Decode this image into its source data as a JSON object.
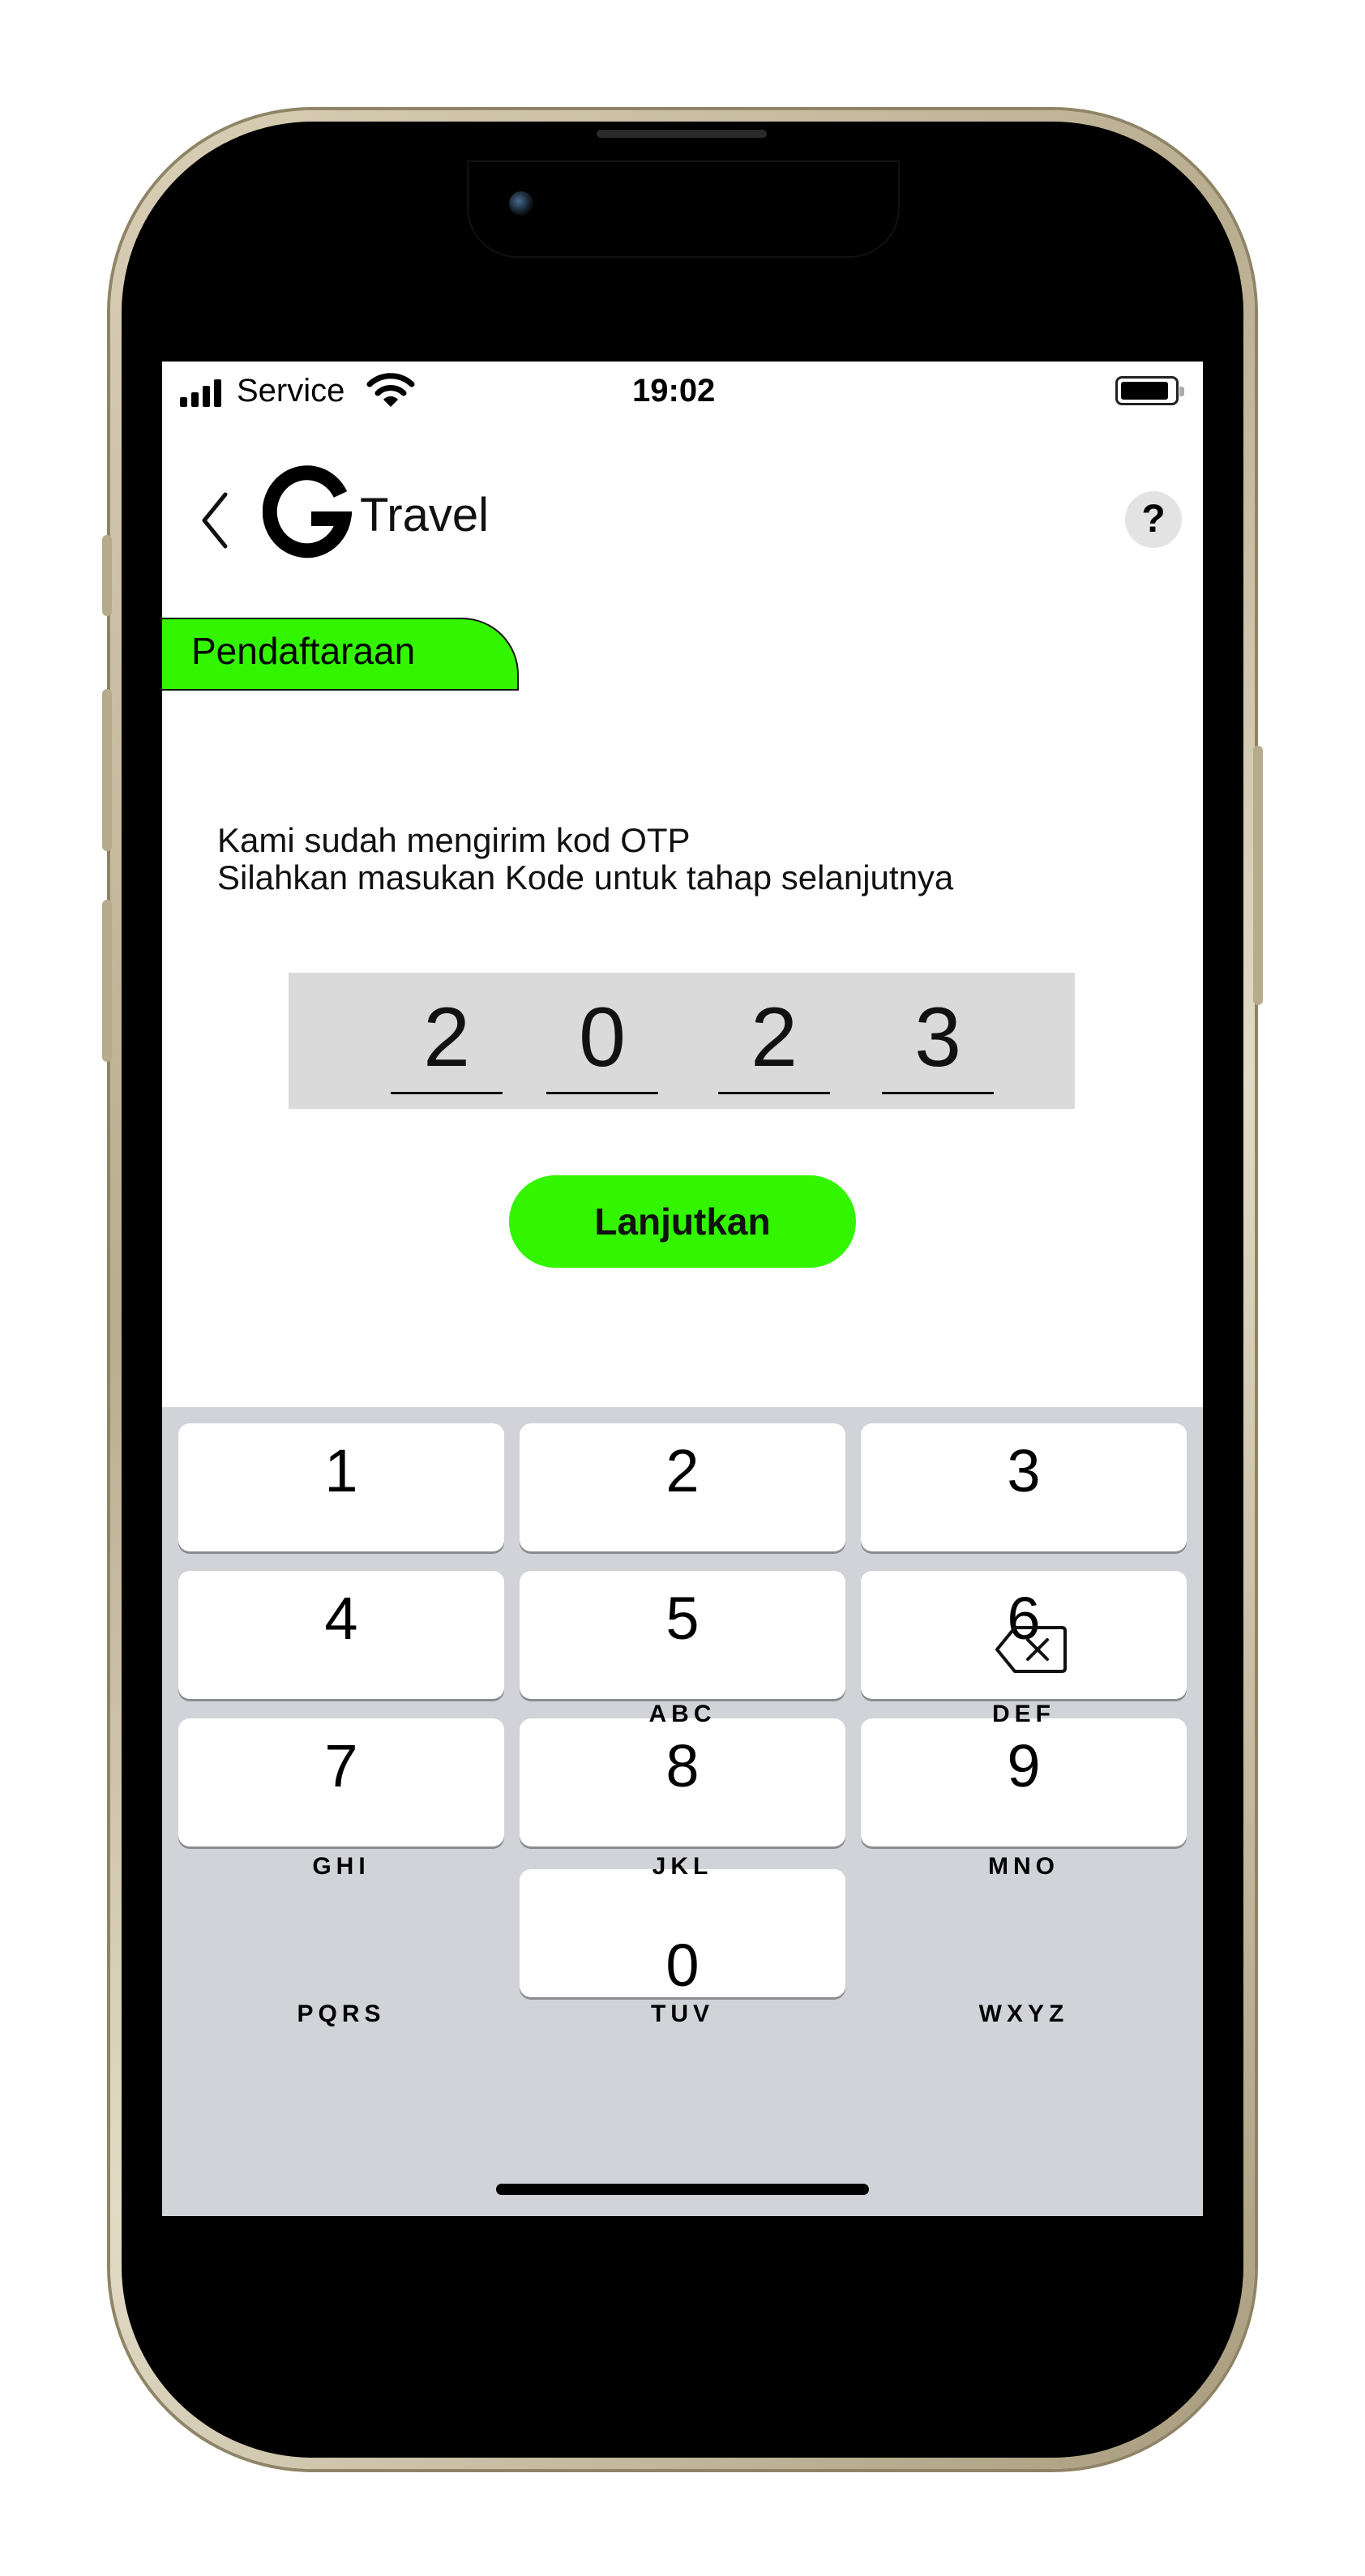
{
  "status_bar": {
    "carrier": "Service",
    "time": "19:02"
  },
  "header": {
    "brand": "Travel",
    "help_label": "?"
  },
  "section_tag": "Pendaftaraan",
  "message": {
    "line1": "Kami sudah mengirim kod OTP",
    "line2": "Silahkan masukan Kode untuk tahap selanjutnya"
  },
  "otp": {
    "digits": [
      "2",
      "0",
      "2",
      "3"
    ]
  },
  "continue_button": "Lanjutkan",
  "keypad": {
    "keys": [
      {
        "number": "1",
        "letters": ""
      },
      {
        "number": "2",
        "letters": "ABC"
      },
      {
        "number": "3",
        "letters": "DEF"
      },
      {
        "number": "4",
        "letters": "GHI"
      },
      {
        "number": "5",
        "letters": "JKL"
      },
      {
        "number": "6",
        "letters": "MNO"
      },
      {
        "number": "7",
        "letters": "PQRS"
      },
      {
        "number": "8",
        "letters": "TUV"
      },
      {
        "number": "9",
        "letters": "WXYZ"
      },
      {
        "number": "0",
        "letters": ""
      }
    ]
  },
  "colors": {
    "accent": "#34f500",
    "keypad_bg": "#d1d3d9",
    "otp_bg": "#dadada"
  }
}
